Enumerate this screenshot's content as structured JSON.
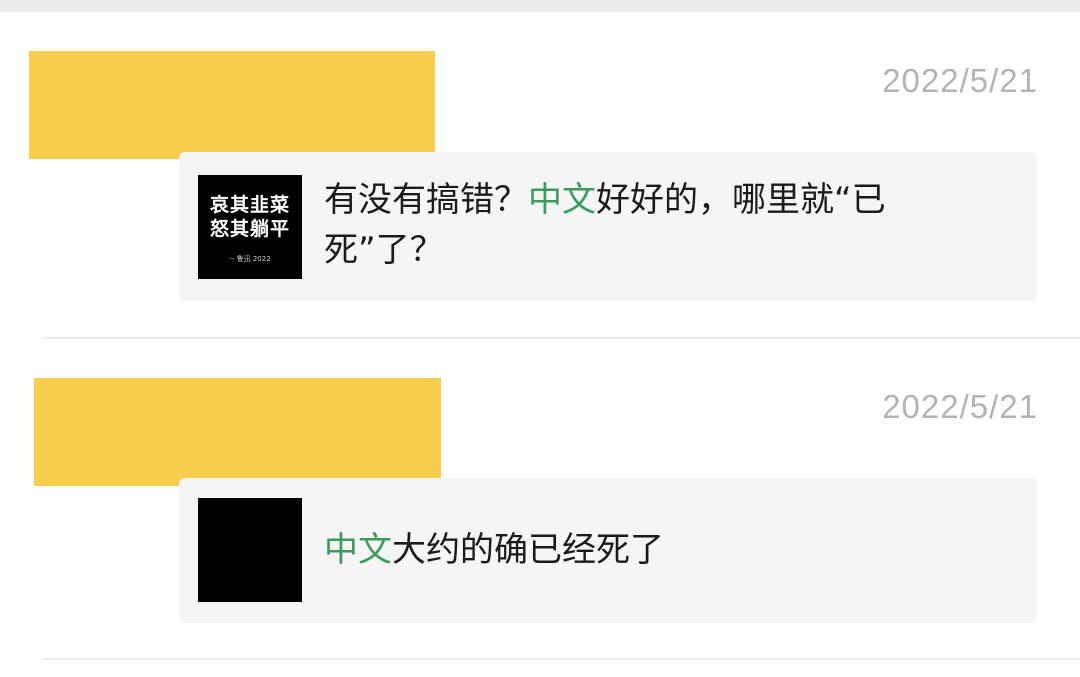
{
  "comments": [
    {
      "timestamp": "2022/5/21",
      "thumbnail": {
        "line1": "哀其韭菜",
        "line2": "怒其躺平",
        "caption": "-- 鲁迅 2022"
      },
      "text_before": "有没有搞错？",
      "highlight": "中文",
      "text_after": "好好的，哪里就“已死”了？"
    },
    {
      "timestamp": "2022/5/21",
      "highlight": "中文",
      "text_after": "大约的确已经死了"
    }
  ],
  "colors": {
    "redaction": "#f8cd4b",
    "highlight": "#3a9b5c",
    "timestamp": "#b3b3b3",
    "card_bg": "#f5f5f5"
  }
}
